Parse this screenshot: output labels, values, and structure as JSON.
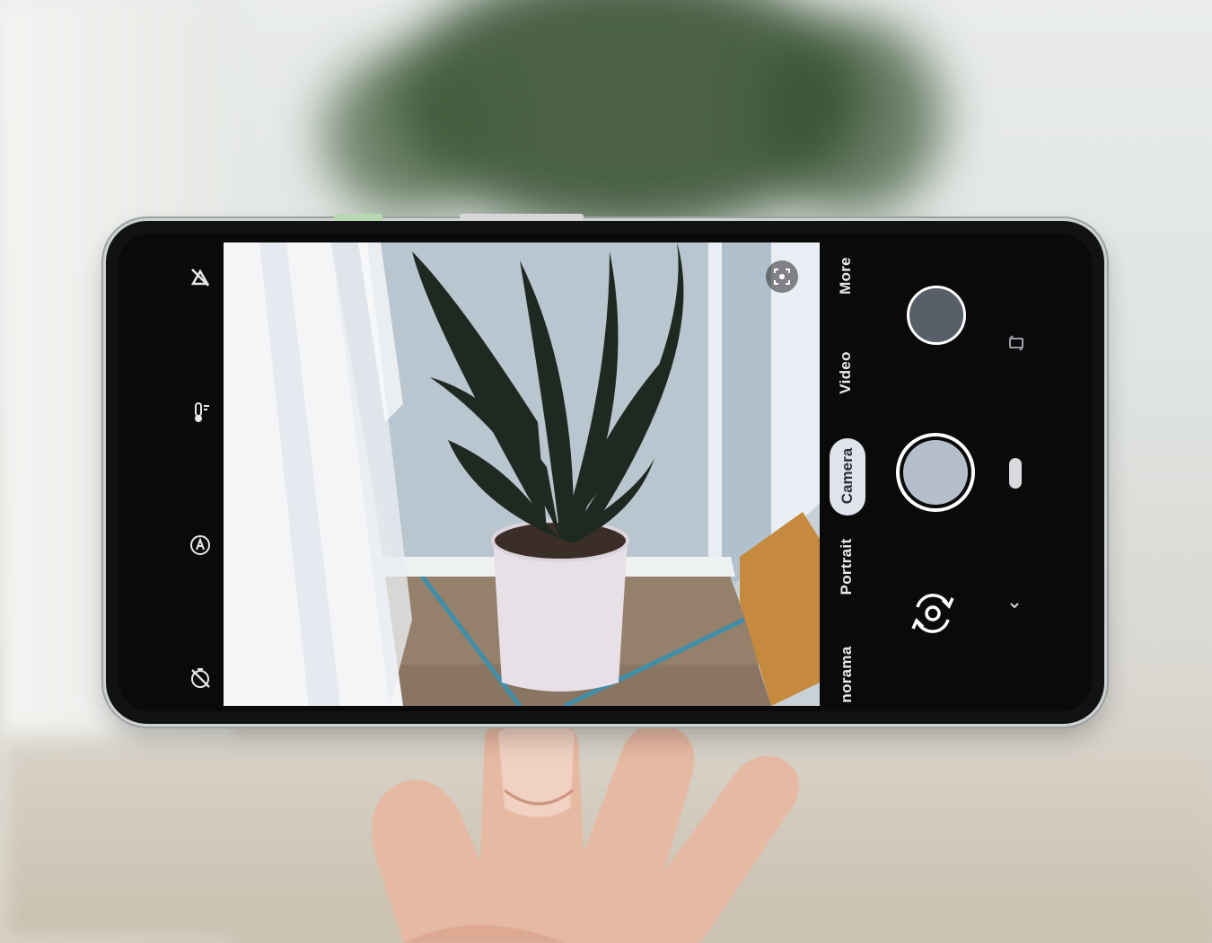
{
  "camera_app": {
    "left_controls": [
      {
        "name": "motion-off-icon"
      },
      {
        "name": "white-balance-icon"
      },
      {
        "name": "auto-exposure-icon"
      },
      {
        "name": "timer-off-icon"
      }
    ],
    "lens_icon": "google-lens-icon",
    "modes": {
      "more": "More",
      "video": "Video",
      "camera": "Camera",
      "portrait": "Portrait",
      "panorama": "norama"
    },
    "active_mode": "Camera",
    "shutter": {
      "icon": "shutter-icon"
    },
    "switch_camera": {
      "icon": "switch-camera-icon"
    },
    "gallery_thumbnail": {
      "icon": "gallery-thumbnail"
    },
    "nav": {
      "rotate_icon": "rotate-icon",
      "home_icon": "home-pill",
      "back_icon": "chevron-down-icon"
    }
  },
  "colors": {
    "accent_pill": "#dfe3ea",
    "shutter_fill": "#b4bfcb",
    "ui_text": "#e9e9e9"
  }
}
